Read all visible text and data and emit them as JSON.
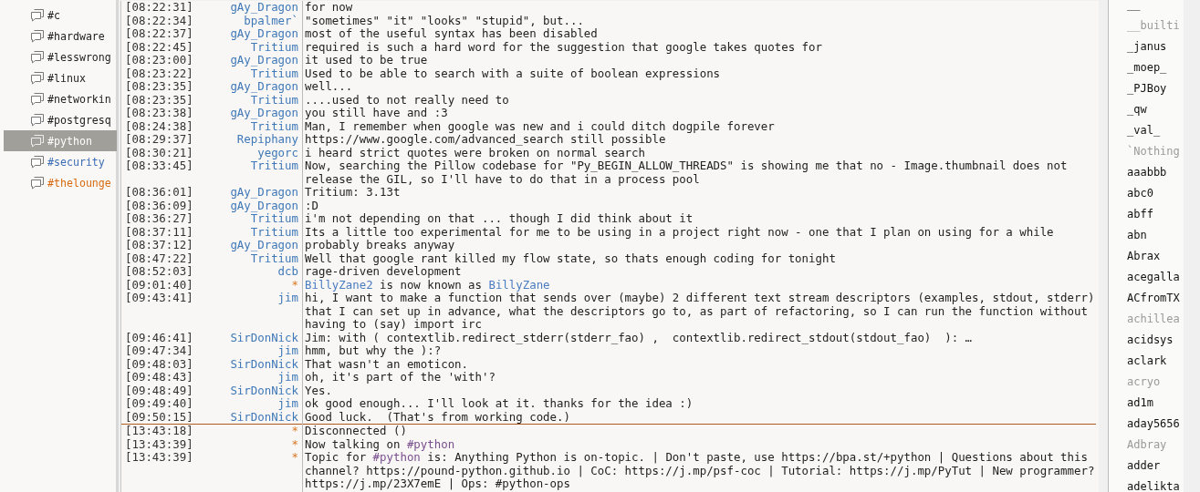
{
  "channels": [
    {
      "name": "#c",
      "selected": false,
      "color": "#222222"
    },
    {
      "name": "#hardware",
      "selected": false,
      "color": "#222222"
    },
    {
      "name": "#lesswrong",
      "selected": false,
      "color": "#222222"
    },
    {
      "name": "#linux",
      "selected": false,
      "color": "#222222"
    },
    {
      "name": "#networkin",
      "selected": false,
      "color": "#222222"
    },
    {
      "name": "#postgresq",
      "selected": false,
      "color": "#222222"
    },
    {
      "name": "#python",
      "selected": true,
      "color": "#ffffff"
    },
    {
      "name": "#security",
      "selected": false,
      "color": "#3a6db5"
    },
    {
      "name": "#thelounge",
      "selected": false,
      "color": "#d86a10"
    }
  ],
  "messages": [
    {
      "kind": "message",
      "time": "[08:22:31]",
      "nick": "gAy_Dragon",
      "text": "for now"
    },
    {
      "kind": "message",
      "time": "[08:22:34]",
      "nick": "bpalmer`",
      "text": "\"sometimes\" \"it\" \"looks\" \"stupid\", but..."
    },
    {
      "kind": "message",
      "time": "[08:22:37]",
      "nick": "gAy_Dragon",
      "text": "most of the useful syntax has been disabled"
    },
    {
      "kind": "message",
      "time": "[08:22:45]",
      "nick": "Tritium",
      "text": "required is such a hard word for the suggestion that google takes quotes for"
    },
    {
      "kind": "message",
      "time": "[08:23:00]",
      "nick": "gAy_Dragon",
      "text": "it used to be true"
    },
    {
      "kind": "message",
      "time": "[08:23:22]",
      "nick": "Tritium",
      "text": "Used to be able to search with a suite of boolean expressions"
    },
    {
      "kind": "message",
      "time": "[08:23:35]",
      "nick": "gAy_Dragon",
      "text": "well..."
    },
    {
      "kind": "message",
      "time": "[08:23:35]",
      "nick": "Tritium",
      "text": "....used to not really need to"
    },
    {
      "kind": "message",
      "time": "[08:23:38]",
      "nick": "gAy_Dragon",
      "text": "you still have and :3"
    },
    {
      "kind": "message",
      "time": "[08:24:38]",
      "nick": "Tritium",
      "text": "Man, I remember when google was new and i could ditch dogpile forever"
    },
    {
      "kind": "message",
      "time": "[08:29:37]",
      "nick": "Repiphany",
      "text": "https://www.google.com/advanced_search still possible"
    },
    {
      "kind": "message",
      "time": "[08:30:21]",
      "nick": "yegorc",
      "text": "i heard strict quotes were broken on normal search"
    },
    {
      "kind": "message",
      "time": "[08:33:45]",
      "nick": "Tritium",
      "text": "Now, searching the Pillow codebase for \"Py_BEGIN_ALLOW_THREADS\" is showing me that no - Image.thumbnail does not release the GIL, so I'll have to do that in a process pool"
    },
    {
      "kind": "message",
      "time": "[08:36:01]",
      "nick": "gAy_Dragon",
      "text": "Tritium: 3.13t"
    },
    {
      "kind": "message",
      "time": "[08:36:09]",
      "nick": "gAy_Dragon",
      "text": ":D"
    },
    {
      "kind": "message",
      "time": "[08:36:27]",
      "nick": "Tritium",
      "text": "i'm not depending on that ... though I did think about it"
    },
    {
      "kind": "message",
      "time": "[08:37:11]",
      "nick": "Tritium",
      "text": "Its a little too experimental for me to be using in a project right now - one that I plan on using for a while"
    },
    {
      "kind": "message",
      "time": "[08:37:12]",
      "nick": "gAy_Dragon",
      "text": "probably breaks anyway"
    },
    {
      "kind": "message",
      "time": "[08:47:22]",
      "nick": "Tritium",
      "text": "Well that google rant killed my flow state, so thats enough coding for tonight"
    },
    {
      "kind": "message",
      "time": "[08:52:03]",
      "nick": "dcb",
      "text": "rage-driven development"
    },
    {
      "kind": "event",
      "time": "[09:01:40]",
      "nick": "*",
      "parts": [
        {
          "text": "BillyZane2",
          "kind": "nick"
        },
        {
          "text": " is now known as ",
          "kind": "plain"
        },
        {
          "text": "BillyZane",
          "kind": "nick"
        }
      ]
    },
    {
      "kind": "message",
      "time": "[09:43:41]",
      "nick": "jim",
      "text": "hi, I want to make a function that sends over (maybe) 2 different text stream descriptors (examples, stdout, stderr) that I can set up in advance, what the descriptors go to, as part of refactoring, so I can run the function without having to (say) import irc"
    },
    {
      "kind": "message",
      "time": "[09:46:41]",
      "nick": "SirDonNick",
      "text": "Jim: with ( contextlib.redirect_stderr(stderr_fao) ,  contextlib.redirect_stdout(stdout_fao)  ): …"
    },
    {
      "kind": "message",
      "time": "[09:47:34]",
      "nick": "jim",
      "text": "hmm, but why the ):?"
    },
    {
      "kind": "message",
      "time": "[09:48:03]",
      "nick": "SirDonNick",
      "text": "That wasn't an emoticon."
    },
    {
      "kind": "message",
      "time": "[09:48:43]",
      "nick": "jim",
      "text": "oh, it's part of the 'with'?"
    },
    {
      "kind": "message",
      "time": "[09:48:49]",
      "nick": "SirDonNick",
      "text": "Yes."
    },
    {
      "kind": "message",
      "time": "[09:49:40]",
      "nick": "jim",
      "text": "ok good enough... I'll look at it. thanks for the idea :)"
    },
    {
      "kind": "message",
      "time": "[09:50:15]",
      "nick": "SirDonNick",
      "text": "Good luck.  (That's from working code.)"
    },
    {
      "kind": "marker"
    },
    {
      "kind": "event",
      "time": "[13:43:18]",
      "nick": "*",
      "text": "Disconnected ()"
    },
    {
      "kind": "event",
      "time": "[13:43:39]",
      "nick": "*",
      "parts": [
        {
          "text": "Now talking on ",
          "kind": "plain"
        },
        {
          "text": "#python",
          "kind": "channel"
        }
      ]
    },
    {
      "kind": "event",
      "time": "[13:43:39]",
      "nick": "*",
      "parts": [
        {
          "text": "Topic for ",
          "kind": "plain"
        },
        {
          "text": "#python",
          "kind": "channel"
        },
        {
          "text": " is: Anything Python is on-topic. | Don't paste, use https://bpa.st/+python | Questions about this channel? https://pound-python.github.io | CoC: https://j.mp/psf-coc | Tutorial: https://j.mp/PyTut | New programmer? https://j.mp/23X7emE | Ops: #python-ops",
          "kind": "plain"
        }
      ]
    }
  ],
  "users": [
    {
      "name": "__",
      "away": false
    },
    {
      "name": "__builti",
      "away": true
    },
    {
      "name": "_janus",
      "away": false
    },
    {
      "name": "_moep_",
      "away": false
    },
    {
      "name": "_PJBoy",
      "away": false
    },
    {
      "name": "_qw",
      "away": false
    },
    {
      "name": "_val_",
      "away": false
    },
    {
      "name": "`Nothing",
      "away": true
    },
    {
      "name": "aaabbb",
      "away": false
    },
    {
      "name": "abc0",
      "away": false
    },
    {
      "name": "abff",
      "away": false
    },
    {
      "name": "abn",
      "away": false
    },
    {
      "name": "Abrax",
      "away": false
    },
    {
      "name": "acegalla",
      "away": false
    },
    {
      "name": "ACfromTX",
      "away": false
    },
    {
      "name": "achillea",
      "away": true
    },
    {
      "name": "acidsys",
      "away": false
    },
    {
      "name": "aclark",
      "away": false
    },
    {
      "name": "acryo",
      "away": true
    },
    {
      "name": "ad1m",
      "away": false
    },
    {
      "name": "aday5656",
      "away": false
    },
    {
      "name": "Adbray",
      "away": true
    },
    {
      "name": "adder",
      "away": false
    },
    {
      "name": "adelikta",
      "away": false
    }
  ]
}
